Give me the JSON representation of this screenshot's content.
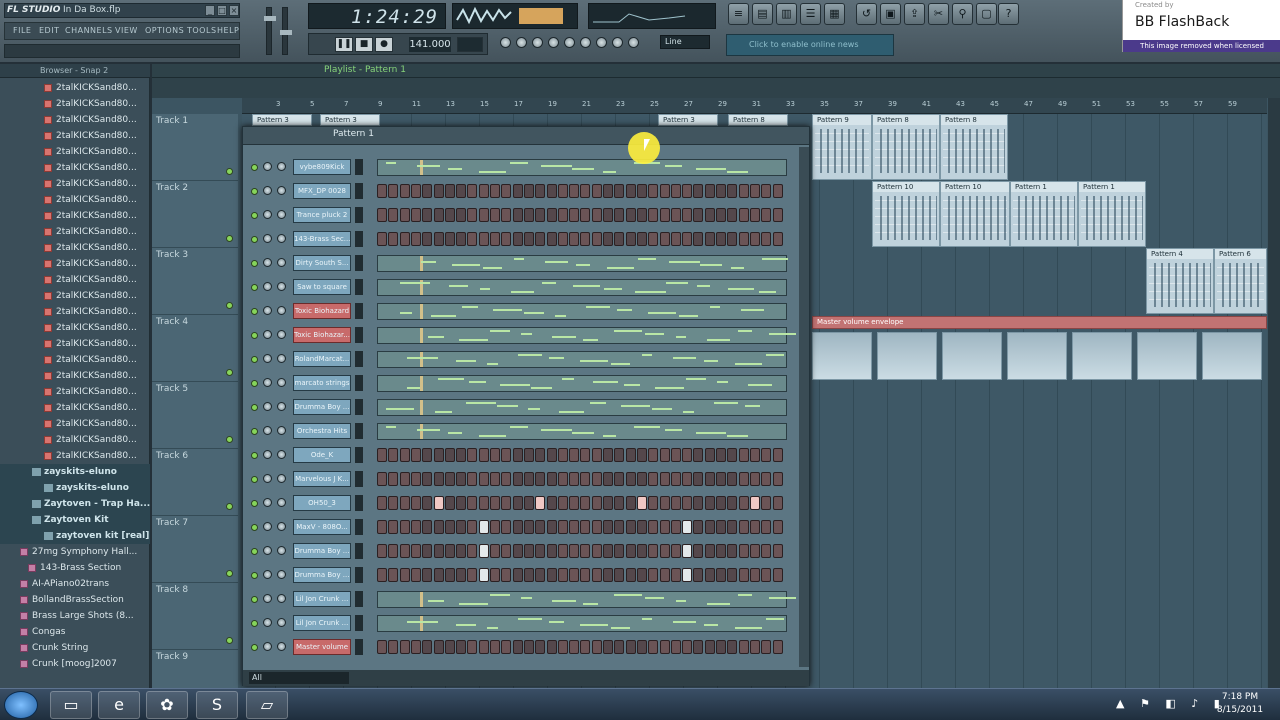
{
  "app": {
    "logo": "FL STUDIO",
    "filename": "In Da Box.flp"
  },
  "menu": [
    "FILE",
    "EDIT",
    "CHANNELS",
    "VIEW",
    "OPTIONS",
    "TOOLS",
    "HELP"
  ],
  "time": "1:24:29",
  "bpm": "141.000",
  "line_mode": "Line",
  "news": "Click to enable online news",
  "watermark": {
    "created": "Created by",
    "title": "BB FlashBack",
    "removed": "This image removed when licensed"
  },
  "browser": {
    "title": "Browser - Snap 2",
    "items": [
      {
        "label": "2talKICKSand80...",
        "kind": "file"
      },
      {
        "label": "2talKICKSand80...",
        "kind": "file"
      },
      {
        "label": "2talKICKSand80...",
        "kind": "file"
      },
      {
        "label": "2talKICKSand80...",
        "kind": "file"
      },
      {
        "label": "2talKICKSand80...",
        "kind": "file"
      },
      {
        "label": "2talKICKSand80...",
        "kind": "file"
      },
      {
        "label": "2talKICKSand80...",
        "kind": "file"
      },
      {
        "label": "2talKICKSand80...",
        "kind": "file"
      },
      {
        "label": "2talKICKSand80...",
        "kind": "file"
      },
      {
        "label": "2talKICKSand80...",
        "kind": "file"
      },
      {
        "label": "2talKICKSand80...",
        "kind": "file"
      },
      {
        "label": "2talKICKSand80...",
        "kind": "file"
      },
      {
        "label": "2talKICKSand80...",
        "kind": "file"
      },
      {
        "label": "2talKICKSand80...",
        "kind": "file"
      },
      {
        "label": "2talKICKSand80...",
        "kind": "file"
      },
      {
        "label": "2talKICKSand80...",
        "kind": "file"
      },
      {
        "label": "2talKICKSand80...",
        "kind": "file"
      },
      {
        "label": "2talKICKSand80...",
        "kind": "file"
      },
      {
        "label": "2talKICKSand80...",
        "kind": "file"
      },
      {
        "label": "2talKICKSand80...",
        "kind": "file"
      },
      {
        "label": "2talKICKSand80...",
        "kind": "file"
      },
      {
        "label": "2talKICKSand80...",
        "kind": "file"
      },
      {
        "label": "2talKICKSand80...",
        "kind": "file"
      },
      {
        "label": "2talKICKSand80...",
        "kind": "file"
      },
      {
        "label": "zayskits-eluno",
        "kind": "folder"
      },
      {
        "label": "zayskits-eluno",
        "kind": "folder2"
      },
      {
        "label": "Zaytoven - Trap Ha...",
        "kind": "folder"
      },
      {
        "label": "Zaytoven Kit",
        "kind": "folder"
      },
      {
        "label": "zaytoven kit [real]",
        "kind": "folder2"
      },
      {
        "label": "27mg Symphony Hall...",
        "kind": "synth"
      },
      {
        "label": "143-Brass Section",
        "kind": "synth2"
      },
      {
        "label": "AI-APiano02trans",
        "kind": "synth"
      },
      {
        "label": "BollandBrassSection",
        "kind": "synth"
      },
      {
        "label": "Brass Large Shots (8...",
        "kind": "synth"
      },
      {
        "label": "Congas",
        "kind": "synth"
      },
      {
        "label": "Crunk String",
        "kind": "synth"
      },
      {
        "label": "Crunk [moog]2007",
        "kind": "synth"
      }
    ]
  },
  "playlist": {
    "title": "Playlist - Pattern 1",
    "ruler": [
      "3",
      "5",
      "7",
      "9",
      "11",
      "13",
      "15",
      "17",
      "19",
      "21",
      "23",
      "25",
      "27",
      "29",
      "31",
      "33",
      "35",
      "37",
      "39",
      "41",
      "43",
      "45",
      "47",
      "49",
      "51",
      "53",
      "55",
      "57",
      "59"
    ],
    "tracks": [
      "Track 1",
      "Track 2",
      "Track 3",
      "Track 4",
      "Track 5",
      "Track 6",
      "Track 7",
      "Track 8",
      "Track 9"
    ],
    "top_clips": [
      "Pattern 3",
      "Pattern 3",
      "Pattern 3",
      "Pattern 8"
    ],
    "clips": [
      {
        "label": "Pattern 9"
      },
      {
        "label": "Pattern 8"
      },
      {
        "label": "Pattern 8"
      },
      {
        "label": "Pattern 10"
      },
      {
        "label": "Pattern 10"
      },
      {
        "label": "Pattern 1"
      },
      {
        "label": "Pattern 1"
      },
      {
        "label": "Pattern 4"
      },
      {
        "label": "Pattern 6"
      }
    ],
    "envelope": "Master volume envelope"
  },
  "stepseq": {
    "pattern": "Pattern 1",
    "filter": "All",
    "channels": [
      {
        "name": "vybe809Kick",
        "mode": "roll",
        "style": "blue"
      },
      {
        "name": "MFX_DP 0028",
        "mode": "steps",
        "style": "blue"
      },
      {
        "name": "Trance pluck 2",
        "mode": "steps",
        "style": "blue"
      },
      {
        "name": "143-Brass Sec...",
        "mode": "steps",
        "style": "blue"
      },
      {
        "name": "Dirty South S...",
        "mode": "roll",
        "style": "blue"
      },
      {
        "name": "Saw to square",
        "mode": "roll",
        "style": "blue"
      },
      {
        "name": "Toxic Biohazard",
        "mode": "roll",
        "style": "red"
      },
      {
        "name": "Toxic Biohazar...",
        "mode": "roll",
        "style": "red"
      },
      {
        "name": "RolandMarcat...",
        "mode": "roll",
        "style": "blue"
      },
      {
        "name": "marcato strings",
        "mode": "roll",
        "style": "blue"
      },
      {
        "name": "Drumma Boy ...",
        "mode": "roll",
        "style": "blue"
      },
      {
        "name": "Orchestra Hits",
        "mode": "roll",
        "style": "blue"
      },
      {
        "name": "Ode_K",
        "mode": "steps",
        "style": "blue"
      },
      {
        "name": "Marvelous J K...",
        "mode": "steps",
        "style": "blue"
      },
      {
        "name": "OH50_3",
        "mode": "steps",
        "style": "blue",
        "on": [
          5,
          14,
          23,
          33
        ]
      },
      {
        "name": "MaxV - 808O...",
        "mode": "steps",
        "style": "blue",
        "on": [
          9,
          27
        ]
      },
      {
        "name": "Drumma Boy ...",
        "mode": "steps",
        "style": "blue",
        "on": [
          9,
          27
        ]
      },
      {
        "name": "Drumma Boy ...",
        "mode": "steps",
        "style": "blue",
        "on": [
          9,
          27
        ]
      },
      {
        "name": "Lil Jon Crunk ...",
        "mode": "roll",
        "style": "blue"
      },
      {
        "name": "Lil Jon Crunk ...",
        "mode": "roll",
        "style": "blue"
      },
      {
        "name": "Master volume",
        "mode": "steps",
        "style": "red"
      }
    ]
  },
  "taskbar": {
    "time": "7:18 PM",
    "date": "8/15/2011"
  }
}
